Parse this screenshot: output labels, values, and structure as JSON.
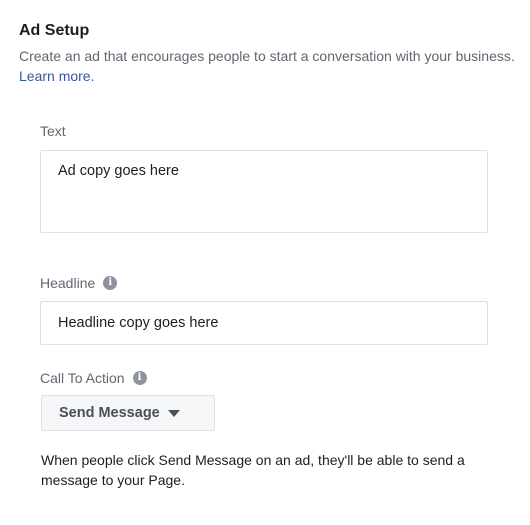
{
  "section": {
    "title": "Ad Setup",
    "description": "Create an ad that encourages people to start a conversation with your business.",
    "learn_more": "Learn more."
  },
  "text_field": {
    "label": "Text",
    "value": "Ad copy goes here"
  },
  "headline_field": {
    "label": "Headline",
    "info_icon": "info-icon",
    "value": "Headline copy goes here"
  },
  "cta_field": {
    "label": "Call To Action",
    "info_icon": "info-icon",
    "selected": "Send Message",
    "help_text": "When people click Send Message on an ad, they'll be able to send a message to your Page."
  },
  "colors": {
    "link": "#385898",
    "muted_text": "#606770",
    "border": "#dddfe2"
  }
}
